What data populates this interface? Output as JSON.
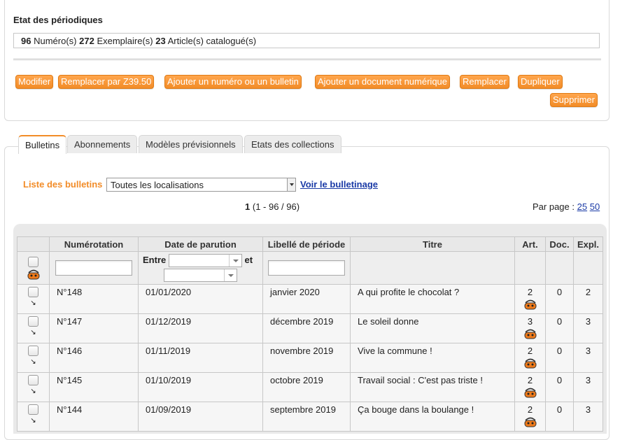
{
  "etat": {
    "title": "Etat des périodiques",
    "numeros_count": "96",
    "numeros_label": "Numéro(s)",
    "exemplaires_count": "272",
    "exemplaires_label": "Exemplaire(s)",
    "articles_count": "23",
    "articles_label": "Article(s) catalogué(s)"
  },
  "actions": {
    "modifier": "Modifier",
    "remplacer_z": "Remplacer par Z39.50",
    "ajouter_numero": "Ajouter un numéro ou un bulletin",
    "ajouter_doc": "Ajouter un document numérique",
    "remplacer": "Remplacer",
    "dupliquer": "Dupliquer",
    "supprimer": "Supprimer"
  },
  "tabs": [
    {
      "label": "Bulletins",
      "active": true
    },
    {
      "label": "Abonnements"
    },
    {
      "label": "Modèles prévisionnels"
    },
    {
      "label": "Etats des collections"
    }
  ],
  "list": {
    "label": "Liste des bulletins",
    "location_selected": "Toutes les localisations",
    "voir_link": "Voir le bulletinage"
  },
  "pager": {
    "current": "1",
    "range": "(1 - 96 / 96)",
    "per_page_label": "Par page :",
    "option_25": "25",
    "option_50": "50"
  },
  "table": {
    "headers": [
      "Numérotation",
      "Date de parution",
      "Libellé de période",
      "Titre",
      "Art.",
      "Doc.",
      "Expl."
    ],
    "filter_between": "Entre",
    "filter_and": "et",
    "rows": [
      {
        "numero": "N°148",
        "date": "01/01/2020",
        "libelle": "janvier 2020",
        "titre": "A qui profite le chocolat ?",
        "art": "2",
        "doc": "0",
        "expl": "2"
      },
      {
        "numero": "N°147",
        "date": "01/12/2019",
        "libelle": "décembre 2019",
        "titre": "Le soleil donne",
        "art": "3",
        "doc": "0",
        "expl": "3"
      },
      {
        "numero": "N°146",
        "date": "01/11/2019",
        "libelle": "novembre 2019",
        "titre": "Vive la commune !",
        "art": "2",
        "doc": "0",
        "expl": "3"
      },
      {
        "numero": "N°145",
        "date": "01/10/2019",
        "libelle": "octobre 2019",
        "titre": "Travail social : C'est pas triste !",
        "art": "2",
        "doc": "0",
        "expl": "3"
      },
      {
        "numero": "N°144",
        "date": "01/09/2019",
        "libelle": "septembre 2019",
        "titre": "Ça bouge dans la boulange !",
        "art": "2",
        "doc": "0",
        "expl": "3"
      }
    ]
  },
  "colors": {
    "accent": "#f28c28",
    "link": "#1a3aa6"
  }
}
